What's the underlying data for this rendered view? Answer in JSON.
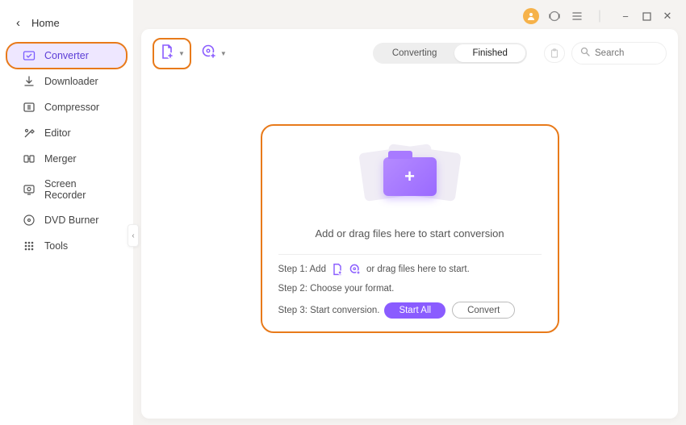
{
  "header": {
    "back_label": "Home"
  },
  "sidebar": {
    "items": [
      {
        "label": "Converter",
        "active": true,
        "highlight": true
      },
      {
        "label": "Downloader"
      },
      {
        "label": "Compressor"
      },
      {
        "label": "Editor"
      },
      {
        "label": "Merger"
      },
      {
        "label": "Screen Recorder"
      },
      {
        "label": "DVD Burner"
      },
      {
        "label": "Tools"
      }
    ]
  },
  "tabs": {
    "converting": "Converting",
    "finished": "Finished",
    "active": "finished"
  },
  "search": {
    "placeholder": "Search"
  },
  "drop": {
    "title": "Add or drag files here to start conversion",
    "step1_pre": "Step 1: Add",
    "step1_post": "or drag files here to start.",
    "step2": "Step 2: Choose your format.",
    "step3": "Step 3: Start conversion.",
    "start_all": "Start All",
    "convert": "Convert"
  }
}
